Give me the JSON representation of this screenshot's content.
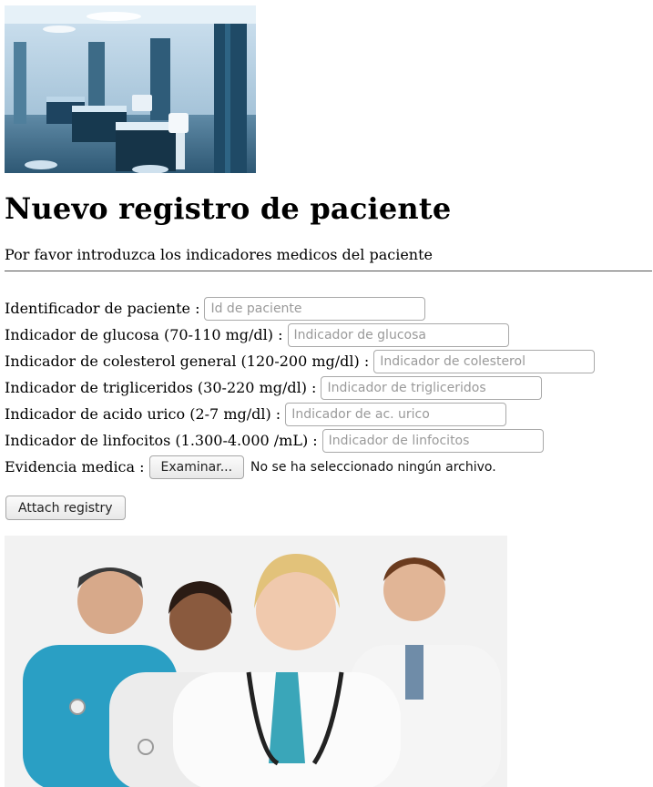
{
  "page": {
    "title": "Nuevo registro de paciente",
    "intro": "Por favor introduzca los indicadores medicos del paciente"
  },
  "images": {
    "top": "hospital-room-photo",
    "bottom": "medical-staff-photo"
  },
  "form": {
    "fields": [
      {
        "label": "Identificador de paciente :",
        "placeholder": "Id de paciente",
        "value": ""
      },
      {
        "label": "Indicador de glucosa (70-110 mg/dl) :",
        "placeholder": "Indicador de glucosa",
        "value": ""
      },
      {
        "label": "Indicador de colesterol general (120-200 mg/dl) :",
        "placeholder": "Indicador de colesterol",
        "value": ""
      },
      {
        "label": "Indicador de trigliceridos (30-220 mg/dl) :",
        "placeholder": "Indicador de trigliceridos",
        "value": ""
      },
      {
        "label": "Indicador de acido urico (2-7 mg/dl) :",
        "placeholder": "Indicador de ac. urico",
        "value": ""
      },
      {
        "label": "Indicador de linfocitos (1.300-4.000 /mL) :",
        "placeholder": "Indicador de linfocitos",
        "value": ""
      }
    ],
    "evidence": {
      "label": "Evidencia medica :",
      "button": "Examinar...",
      "status": "No se ha seleccionado ningún archivo."
    },
    "submit": "Attach registry"
  }
}
